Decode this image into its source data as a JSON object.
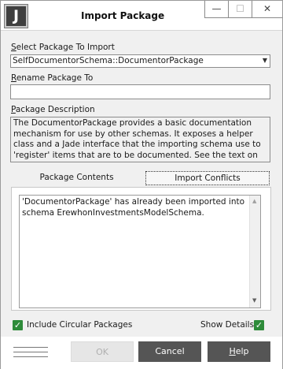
{
  "window": {
    "title": "Import Package",
    "logo_letter": "J",
    "minimize_glyph": "—",
    "maximize_glyph": "☐",
    "close_glyph": "✕"
  },
  "select_package": {
    "label_first": "S",
    "label_rest": "elect Package To Import",
    "value": "SelfDocumentorSchema::DocumentorPackage",
    "dropdown_icon": "chevron-down-icon"
  },
  "rename": {
    "label_first": "R",
    "label_rest": "ename Package To",
    "value": ""
  },
  "description": {
    "label_first": "P",
    "label_rest": "ackage Description",
    "text": "The DocumentorPackage provides a basic documentation mechanism for use by other schemas. It exposes a helper class and a Jade interface that the importing schema use to 'register' items that are to be documented. See the text on DocumentHub for more"
  },
  "tabs": {
    "contents": "Package Contents",
    "conflicts": "Import Conflicts",
    "active": "conflicts"
  },
  "conflicts_text": "'DocumentorPackage' has already been imported into schema ErewhonInvestmentsModelSchema.",
  "options": {
    "include_circular": {
      "label": "Include Circular Packages",
      "checked": true
    },
    "show_details": {
      "label": "Show Details",
      "checked": true
    }
  },
  "buttons": {
    "ok": "OK",
    "cancel": "Cancel",
    "help_first": "H",
    "help_rest": "elp"
  },
  "colors": {
    "check_green": "#2e8b3a",
    "button_dark": "#555555",
    "logo_dark": "#3f3f3f"
  }
}
